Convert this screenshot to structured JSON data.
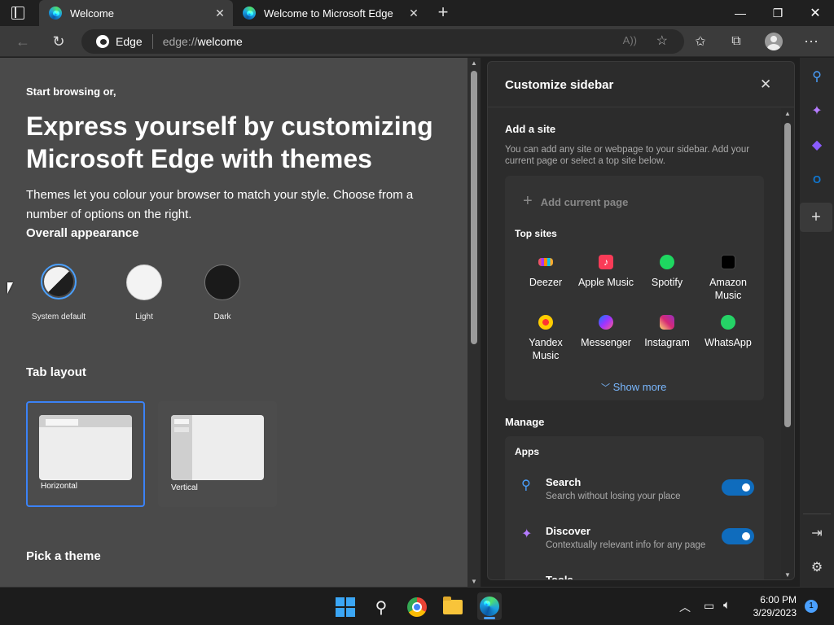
{
  "tabs": [
    {
      "title": "Welcome"
    },
    {
      "title": "Welcome to Microsoft Edge"
    }
  ],
  "address": {
    "site_name": "Edge",
    "url_prefix": "edge://",
    "url_path": "welcome"
  },
  "page": {
    "intro": "Start browsing or,",
    "heading_line1": "Express yourself by customizing",
    "heading_line2": "Microsoft Edge with themes",
    "desc_line1": "Themes let you colour your browser to match your style. Choose from a",
    "desc_line2": "number of options on the right.",
    "appearance_title": "Overall appearance",
    "appearance_options": [
      {
        "label": "System default"
      },
      {
        "label": "Light"
      },
      {
        "label": "Dark"
      }
    ],
    "tab_layout_title": "Tab layout",
    "tab_layouts": [
      {
        "label": "Horizontal"
      },
      {
        "label": "Vertical"
      }
    ],
    "pick_theme_title": "Pick a theme"
  },
  "panel": {
    "title": "Customize sidebar",
    "add_site_title": "Add a site",
    "add_site_desc_line1": "You can add any site or webpage to your sidebar. Add your",
    "add_site_desc_line2": "current page or select a top site below.",
    "add_current_page": "Add current page",
    "top_sites_title": "Top sites",
    "top_sites": [
      {
        "line1": "Deezer",
        "line2": ""
      },
      {
        "line1": "Apple Music",
        "line2": ""
      },
      {
        "line1": "Spotify",
        "line2": ""
      },
      {
        "line1": "Amazon",
        "line2": "Music"
      },
      {
        "line1": "Yandex",
        "line2": "Music"
      },
      {
        "line1": "Messenger",
        "line2": ""
      },
      {
        "line1": "Instagram",
        "line2": ""
      },
      {
        "line1": "WhatsApp",
        "line2": ""
      }
    ],
    "show_more": "Show more",
    "manage_title": "Manage",
    "apps_title": "Apps",
    "apps": [
      {
        "name": "Search",
        "desc": "Search without losing your place",
        "enabled": true
      },
      {
        "name": "Discover",
        "desc": "Contextually relevant info for any page",
        "enabled": true
      },
      {
        "name": "Tools",
        "desc": "",
        "enabled": false
      }
    ]
  },
  "taskbar": {
    "time": "6:00 PM",
    "date": "3/29/2023",
    "notification_count": "1"
  },
  "colors": {
    "accent": "#0f6cbd",
    "page_bg": "#4a4a4a",
    "panel_bg": "#2c2c2c"
  }
}
